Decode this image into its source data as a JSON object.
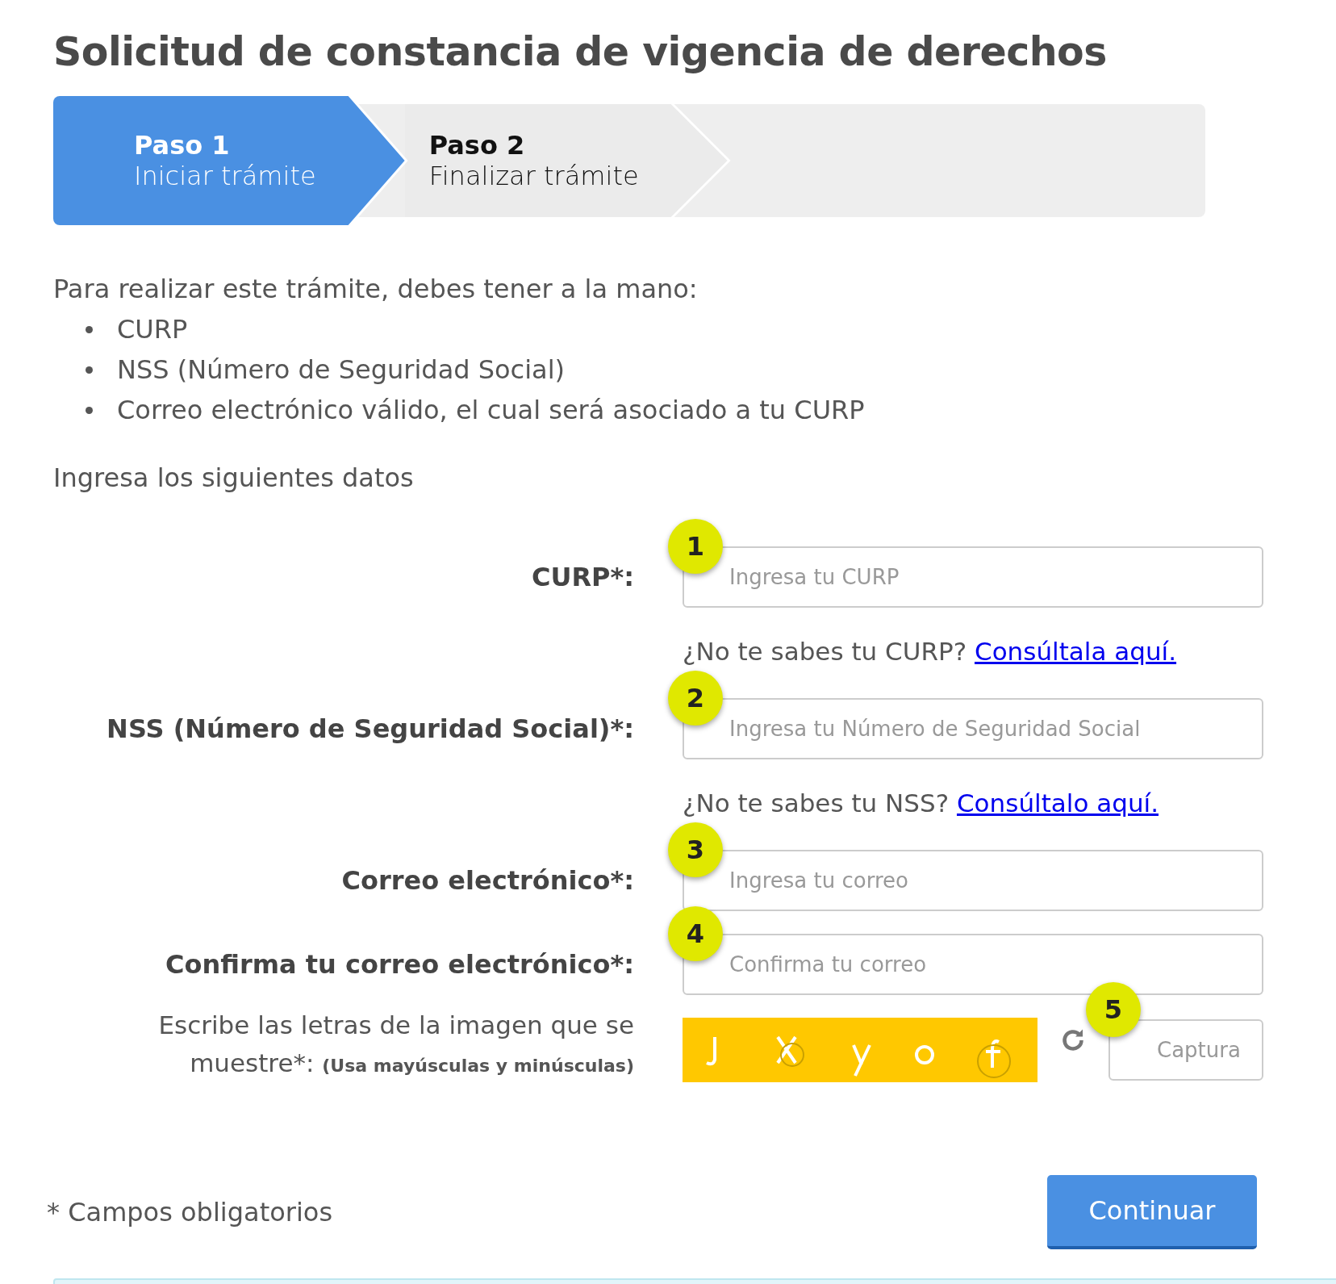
{
  "title": "Solicitud de constancia de vigencia de derechos",
  "steps": [
    {
      "number": "Paso 1",
      "label": "Iniciar trámite",
      "selected": true
    },
    {
      "number": "Paso 2",
      "label": "Finalizar trámite",
      "selected": false
    }
  ],
  "intro": "Para realizar este trámite, debes tener a la mano:",
  "requirements": [
    "CURP",
    "NSS (Número de Seguridad Social)",
    "Correo electrónico válido, el cual será asociado a tu CURP"
  ],
  "form_heading": "Ingresa los siguientes datos",
  "fields": [
    {
      "label": "CURP*:",
      "placeholder": "Ingresa tu CURP",
      "badge": "1",
      "hint": {
        "text": "¿No te sabes tu CURP?",
        "link": "Consúltala aquí."
      }
    },
    {
      "label": "NSS (Número de Seguridad Social)*:",
      "placeholder": "Ingresa tu Número de Seguridad Social",
      "badge": "2",
      "hint": {
        "text": "¿No te sabes tu NSS?",
        "link": "Consúltalo aquí."
      }
    },
    {
      "label": "Correo electrónico*:",
      "placeholder": "Ingresa tu correo",
      "badge": "3"
    },
    {
      "label": "Confirma tu correo electrónico*:",
      "placeholder": "Confirma tu correo",
      "badge": "4"
    }
  ],
  "captcha": {
    "label": "Escribe las letras de la imagen que se muestre*: **(Usa mayúsculas y minúsculas)**",
    "placeholder": "Captura",
    "badge": "5"
  },
  "required_note": "* Campos obligatorios",
  "submit": "Continuar"
}
